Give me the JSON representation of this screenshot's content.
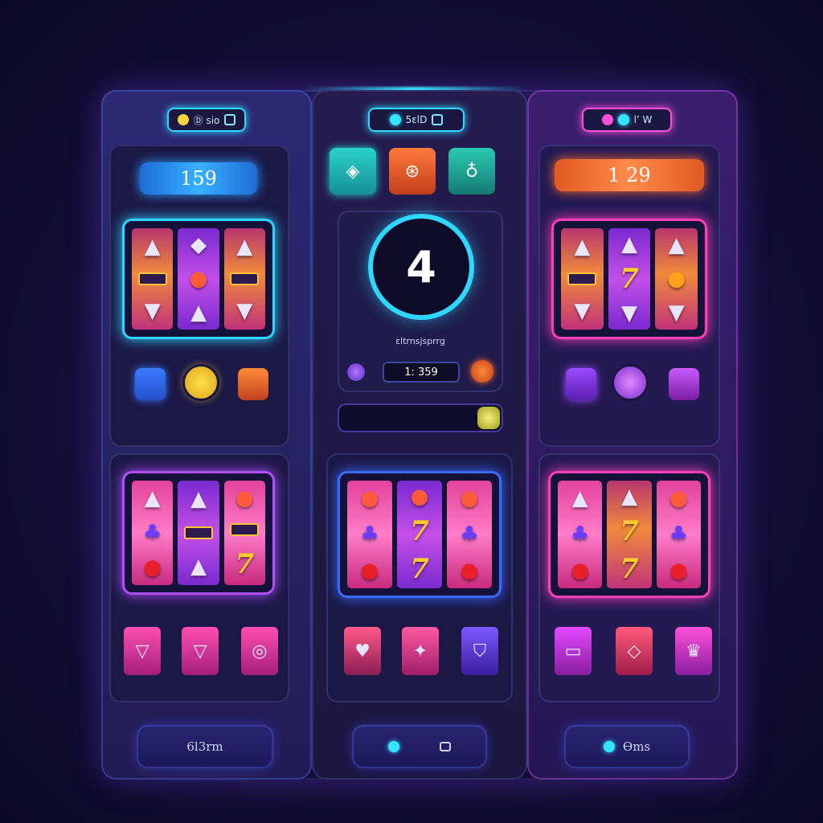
{
  "colors": {
    "cyan": "#2fd6ff",
    "pink": "#ff3fb8",
    "violet": "#b04fff",
    "orange": "#ff6a30",
    "background": "#160f3a"
  },
  "left": {
    "top_chip_text": "Ⓓ sio",
    "balance": "159",
    "bottom_label": "6l3rm"
  },
  "middle": {
    "top_chip_text": "5ɛlD",
    "counter": "4",
    "caption": "ɛltrnsjsprrg",
    "value_display": "1: 359"
  },
  "right": {
    "top_chip_text": "l’ W",
    "balance": "1 29",
    "bottom_label": "Ɵms"
  },
  "icons": {
    "top_tiles": [
      "diamond-icon",
      "coin-icon",
      "bag-icon"
    ],
    "reel_symbols": [
      "cherry-icon",
      "grape-icon",
      "seven-icon",
      "bar-icon",
      "triangle-icon"
    ]
  }
}
